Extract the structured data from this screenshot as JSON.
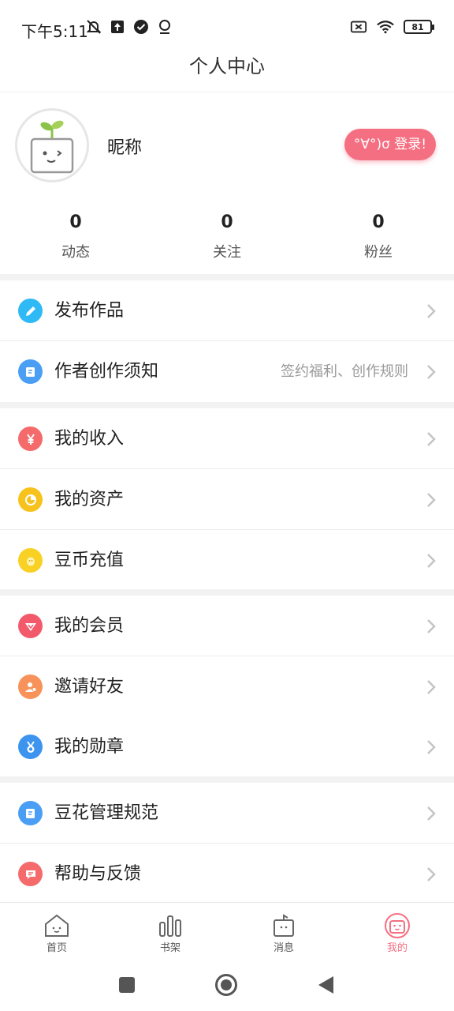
{
  "status_bar": {
    "time": "下午5:11",
    "battery": "81",
    "icons": [
      "mute-bell-icon",
      "upload-icon",
      "check-circle-icon",
      "location-icon",
      "no-sim-icon",
      "wifi-icon",
      "battery-icon"
    ]
  },
  "header": {
    "title": "个人中心"
  },
  "profile": {
    "nickname": "昵称",
    "login_label": "°∀°)σ 登录!",
    "stats": [
      {
        "value": "0",
        "label": "动态"
      },
      {
        "value": "0",
        "label": "关注"
      },
      {
        "value": "0",
        "label": "粉丝"
      }
    ]
  },
  "menu": {
    "publish": {
      "label": "发布作品",
      "icon": "pencil-icon",
      "color": "#2fb9f5"
    },
    "author_notice": {
      "label": "作者创作须知",
      "sub": "签约福利、创作规则",
      "icon": "book-icon",
      "color": "#4a9ff5"
    },
    "income": {
      "label": "我的收入",
      "icon": "yuan-icon",
      "color": "#f56a6a"
    },
    "assets": {
      "label": "我的资产",
      "icon": "pie-icon",
      "color": "#f7c21b"
    },
    "recharge": {
      "label": "豆币充值",
      "icon": "coin-icon",
      "color": "#f9d024"
    },
    "vip": {
      "label": "我的会员",
      "icon": "vip-icon",
      "color": "#f25a6b"
    },
    "invite": {
      "label": "邀请好友",
      "icon": "friend-icon",
      "color": "#f7935a"
    },
    "medal": {
      "label": "我的勋章",
      "icon": "medal-icon",
      "color": "#3d94ef"
    },
    "rules": {
      "label": "豆花管理规范",
      "icon": "rules-book-icon",
      "color": "#4a9ff5"
    },
    "help": {
      "label": "帮助与反馈",
      "icon": "message-icon",
      "color": "#f56a6a"
    }
  },
  "tabbar": {
    "home": "首页",
    "shelf": "书架",
    "messages": "消息",
    "mine": "我的",
    "active_color": "#f56f82"
  }
}
